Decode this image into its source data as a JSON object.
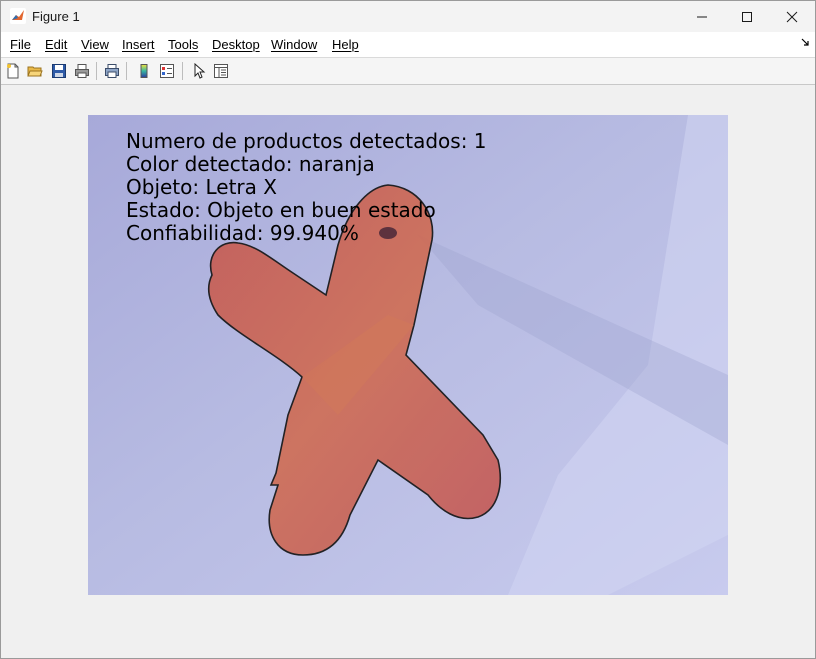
{
  "window": {
    "title": "Figure 1",
    "controls": {
      "minimize": "minimize",
      "maximize": "maximize",
      "close": "close"
    }
  },
  "menubar": {
    "items": [
      {
        "label": "File"
      },
      {
        "label": "Edit"
      },
      {
        "label": "View"
      },
      {
        "label": "Insert"
      },
      {
        "label": "Tools"
      },
      {
        "label": "Desktop"
      },
      {
        "label": "Window"
      },
      {
        "label": "Help"
      }
    ]
  },
  "toolbar": {
    "buttons": [
      "new-figure-icon",
      "open-file-icon",
      "save-icon",
      "print-icon",
      "print-preview-icon",
      "colorbar-icon",
      "legend-icon",
      "edit-plot-icon",
      "property-inspector-icon"
    ]
  },
  "figure": {
    "overlay_lines": [
      "Numero de productos detectados: 1",
      "Color detectado: naranja",
      "Objeto: Letra X",
      "Estado: Objeto en buen estado",
      "Confiabilidad: 99.940%"
    ],
    "colors": {
      "background": "#b9bce0",
      "object": "#c96a5b",
      "outline": "#1a1a1a"
    }
  }
}
